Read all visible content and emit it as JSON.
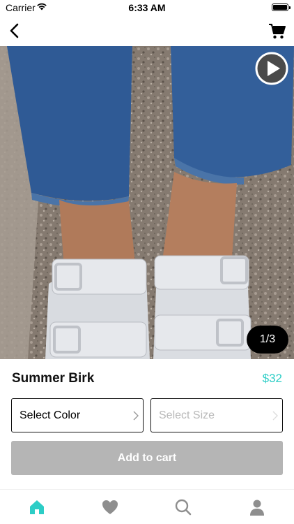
{
  "status_bar": {
    "carrier": "Carrier",
    "time": "6:33 AM"
  },
  "nav": {
    "back_icon": "chevron-left-icon",
    "cart_icon": "shopping-cart-icon"
  },
  "product": {
    "image_counter": "1/3",
    "title": "Summer Birk",
    "price": "$32"
  },
  "options": {
    "color_label": "Select Color",
    "size_label": "Select Size"
  },
  "actions": {
    "add_to_cart": "Add to cart"
  },
  "tab_bar": {
    "items": [
      "home-icon",
      "heart-icon",
      "search-icon",
      "profile-icon"
    ],
    "active_color": "#2ccdc6",
    "inactive_color": "#8e8e8e"
  },
  "colors": {
    "accent": "#2ccdc6",
    "disabled_button": "#b5b5b5"
  }
}
